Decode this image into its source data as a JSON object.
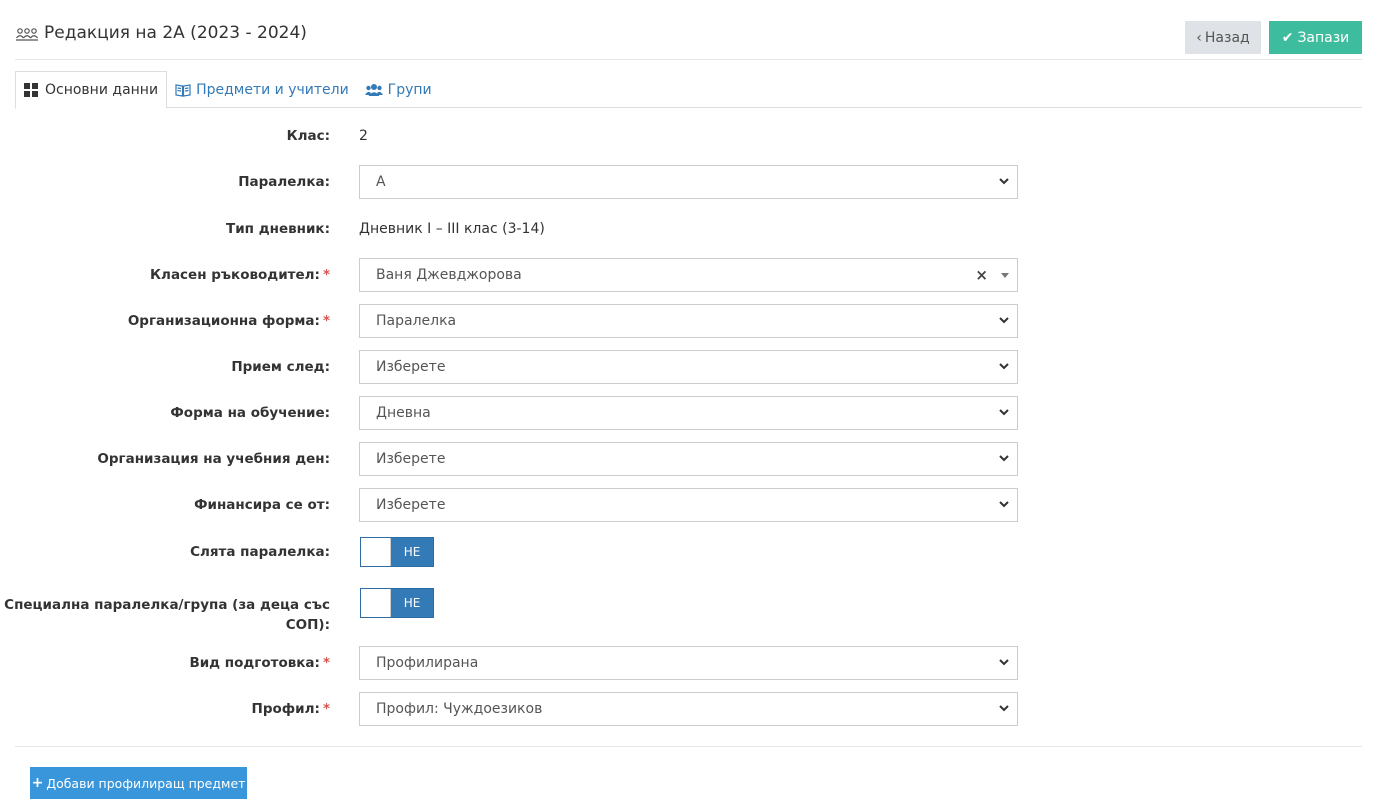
{
  "header": {
    "title": "Редакция на 2А (2023 - 2024)",
    "back_label": "Назад",
    "save_label": "Запази"
  },
  "tabs": [
    {
      "label": "Основни данни",
      "active": true
    },
    {
      "label": "Предмети и учители",
      "active": false
    },
    {
      "label": "Групи",
      "active": false
    }
  ],
  "form": {
    "class": {
      "label": "Клас:",
      "value": "2"
    },
    "paralelka": {
      "label": "Паралелка:",
      "value": "А"
    },
    "diary_type": {
      "label": "Тип дневник:",
      "value": "Дневник I – III клас (3-14)"
    },
    "class_teacher": {
      "label": "Класен ръководител:",
      "value": "Ваня Джевджорова",
      "required": true
    },
    "org_form": {
      "label": "Организационна форма:",
      "value": "Паралелка",
      "required": true
    },
    "admission_after": {
      "label": "Прием след:",
      "value": "Изберете"
    },
    "study_form": {
      "label": "Форма на обучение:",
      "value": "Дневна"
    },
    "day_org": {
      "label": "Организация на учебния ден:",
      "value": "Изберете"
    },
    "financed_by": {
      "label": "Финансира се от:",
      "value": "Изберете"
    },
    "merged": {
      "label": "Слята паралелка:",
      "toggle_text": "НЕ",
      "on": false
    },
    "special": {
      "label_line1": "Специална паралелка/група (за деца със",
      "label_line2": "СОП):",
      "toggle_text": "НЕ",
      "on": false
    },
    "training_type": {
      "label": "Вид подготовка:",
      "value": "Профилирана",
      "required": true
    },
    "profile": {
      "label": "Профил:",
      "value": "Профил: Чуждоезиков",
      "required": true
    }
  },
  "required_mark": "*",
  "add_button_label": "Добави профилиращ предмет",
  "colors": {
    "primary": "#337ab7",
    "success": "#3dbc9e",
    "add": "#3a96db",
    "required": "#d9534f"
  }
}
